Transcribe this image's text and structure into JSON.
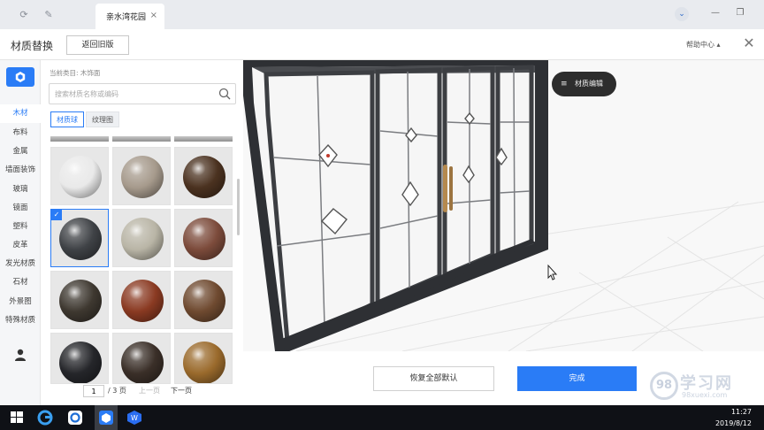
{
  "window": {
    "tab_title": "亲水湾花园",
    "tab_close": "×"
  },
  "header": {
    "title": "材质替换",
    "back_button": "返回旧版",
    "help": "帮助中心 ▴"
  },
  "rail": {
    "categories": [
      "木材",
      "布料",
      "金属",
      "墙面装饰",
      "玻璃",
      "镜面",
      "塑料",
      "皮革",
      "发光材质",
      "石材",
      "外景图",
      "特殊材质"
    ],
    "active_index": 0
  },
  "panel": {
    "current_category": "当前类目: 木饰面",
    "search_placeholder": "搜索材质名称或编码",
    "tabs": [
      "材质球",
      "纹理图"
    ],
    "active_tab": 0,
    "materials": [
      {
        "name": "white-gloss",
        "color": "#e9e9e9"
      },
      {
        "name": "grey-wood",
        "color": "#a69a8c"
      },
      {
        "name": "dark-walnut",
        "color": "#4b3220"
      },
      {
        "name": "charcoal",
        "color": "#3f4246",
        "selected": true
      },
      {
        "name": "light-ash",
        "color": "#b9b5a6"
      },
      {
        "name": "mahogany-brown",
        "color": "#7c4b3b"
      },
      {
        "name": "dark-oak",
        "color": "#3e3830"
      },
      {
        "name": "cherry-red",
        "color": "#8a3a22"
      },
      {
        "name": "teak",
        "color": "#6f4a30"
      },
      {
        "name": "black-wood",
        "color": "#25262a"
      },
      {
        "name": "smoked-wood",
        "color": "#3a2f28"
      },
      {
        "name": "golden-oak",
        "color": "#9a6a2c"
      }
    ],
    "pager": {
      "current": "1",
      "total": "/ 3 页",
      "prev": "上一页",
      "next": "下一页"
    }
  },
  "viewport": {
    "edit_button": "材质编辑",
    "edit_icon": "≡"
  },
  "actions": {
    "reset": "恢复全部默认",
    "done": "完成"
  },
  "watermark": {
    "main": "学习网",
    "sub": "98xuexi.com",
    "circle": "98"
  },
  "taskbar": {
    "time": "11:27",
    "date": "2019/8/12"
  },
  "colors": {
    "accent": "#2a7cf6",
    "frame": "#3c3e42"
  }
}
